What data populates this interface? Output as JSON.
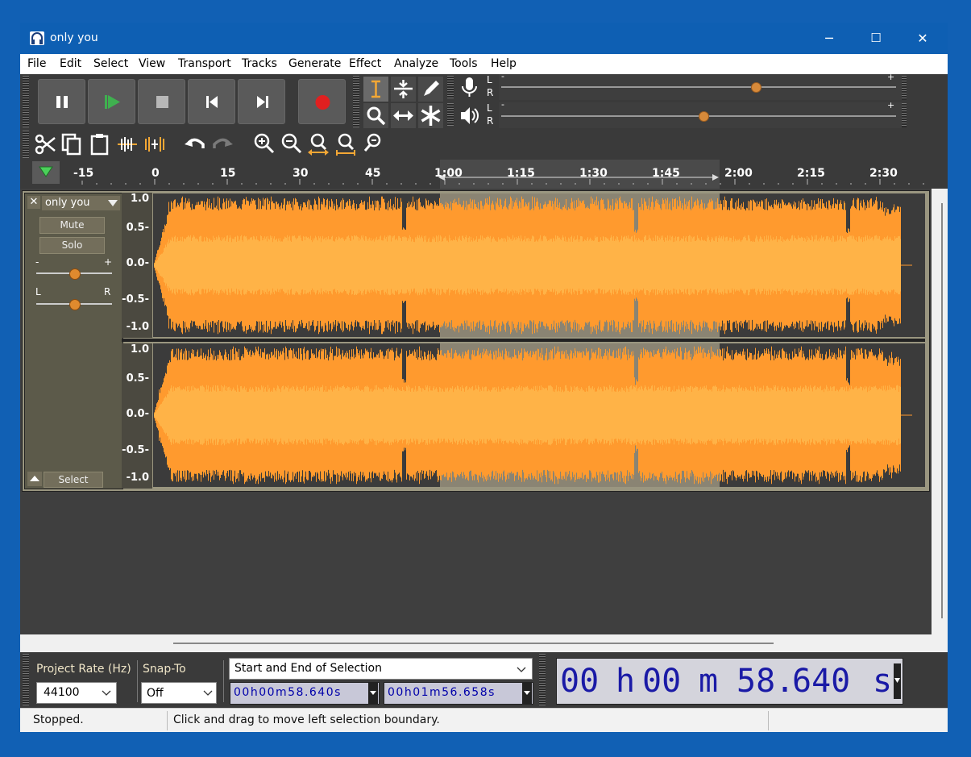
{
  "window": {
    "title": "only you",
    "minimize": "─",
    "maximize": "☐",
    "close": "✕"
  },
  "menu": [
    "File",
    "Edit",
    "Select",
    "View",
    "Transport",
    "Tracks",
    "Generate",
    "Effect",
    "Analyze",
    "Tools",
    "Help"
  ],
  "meters": {
    "rec_lr": [
      "L",
      "R"
    ],
    "play_lr": [
      "L",
      "R"
    ],
    "minus": "-",
    "plus": "+"
  },
  "ruler": {
    "labels": [
      "-15",
      "0",
      "15",
      "30",
      "45",
      "1:00",
      "1:15",
      "1:30",
      "1:45",
      "2:00",
      "2:15",
      "2:30"
    ]
  },
  "track": {
    "name": "only you",
    "close_glyph": "✕",
    "mute": "Mute",
    "solo": "Solo",
    "gain_minus": "-",
    "gain_plus": "+",
    "pan_left": "L",
    "pan_right": "R",
    "select": "Select",
    "scale": [
      "1.0",
      "0.5-",
      "0.0-",
      "-0.5-",
      "-1.0"
    ],
    "gain_level": 0.5,
    "pan_level": 0.5
  },
  "selection_toolbar": {
    "project_rate_label": "Project Rate (Hz)",
    "project_rate": "44100",
    "snap_to_label": "Snap-To",
    "snap_to": "Off",
    "selection_mode": "Start and End of Selection",
    "start_time": "00h00m58.640s",
    "end_time": "00h01m56.658s",
    "big_time": {
      "h": "00",
      "h_unit": "h",
      "m": "00",
      "m_unit": "m",
      "s1": "58",
      "s_dot": ".",
      "s2": "640",
      "s_unit": "s"
    }
  },
  "status": {
    "left": "Stopped.",
    "right": "Click and drag to move left selection boundary."
  },
  "colors": {
    "wave_outer": "#ff9a2e",
    "wave_inner": "#ffb347",
    "selection": "#8a8473",
    "accent": "#0e5fb3"
  }
}
